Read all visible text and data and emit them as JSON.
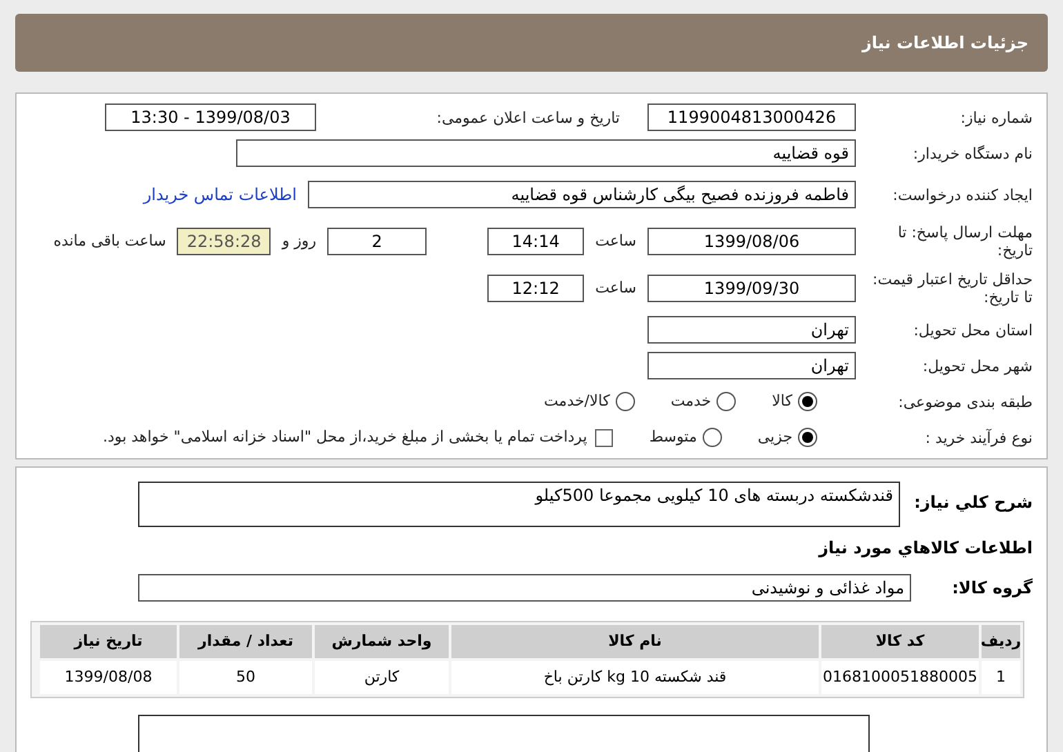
{
  "header": {
    "title": "جزئیات اطلاعات نیاز"
  },
  "details": {
    "need_number": {
      "label": "شماره نیاز:",
      "value": "1199004813000426"
    },
    "announce": {
      "label": "تاریخ و ساعت اعلان عمومی:",
      "value": "1399/08/03 - 13:30"
    },
    "buyer": {
      "label": "نام دستگاه خریدار:",
      "value": "قوه قضاییه"
    },
    "creator": {
      "label": "ایجاد کننده درخواست:",
      "value": "فاطمه فروزنده فصیح بیگی کارشناس قوه قضاییه",
      "link": "اطلاعات تماس خریدار"
    },
    "deadline": {
      "label": "مهلت ارسال پاسخ: تا تاریخ:",
      "date": "1399/08/06",
      "time_label": "ساعت",
      "time": "14:14",
      "days": "2",
      "days_label": "روز و",
      "remaining": "22:58:28",
      "remaining_label": "ساعت باقی مانده"
    },
    "validity": {
      "label": "حداقل تاریخ اعتبار قیمت: تا تاریخ:",
      "date": "1399/09/30",
      "time_label": "ساعت",
      "time": "12:12"
    },
    "province": {
      "label": "استان محل تحویل:",
      "value": "تهران"
    },
    "city": {
      "label": "شهر محل تحویل:",
      "value": "تهران"
    },
    "category": {
      "label": "طبقه بندی موضوعی:",
      "options": [
        {
          "label": "کالا",
          "selected": true
        },
        {
          "label": "خدمت",
          "selected": false
        },
        {
          "label": "کالا/خدمت",
          "selected": false
        }
      ]
    },
    "process": {
      "label": "نوع فرآیند خرید :",
      "options": [
        {
          "label": "جزیی",
          "selected": true
        },
        {
          "label": "متوسط",
          "selected": false
        }
      ],
      "treasury": {
        "label": "پرداخت تمام یا بخشی از مبلغ خرید،از محل \"اسناد خزانه اسلامی\" خواهد بود.",
        "checked": false
      }
    }
  },
  "summary": {
    "label": "شرح کلي نیاز:",
    "value": "قندشکسته دربسته های 10 کیلویی مجموعا 500کیلو"
  },
  "goods_heading": "اطلاعات کالاهاي مورد نیاز",
  "goods_group": {
    "label": "گروه کالا:",
    "value": "مواد غذائی و نوشیدنی"
  },
  "table": {
    "columns": [
      "ردیف",
      "کد کالا",
      "نام کالا",
      "واحد شمارش",
      "تعداد / مقدار",
      "تاریخ نیاز"
    ],
    "rows": [
      [
        "1",
        "0168100051880005",
        "قند شکسته 10 kg کارتن باخ",
        "کارتن",
        "50",
        "1399/08/08"
      ]
    ]
  }
}
